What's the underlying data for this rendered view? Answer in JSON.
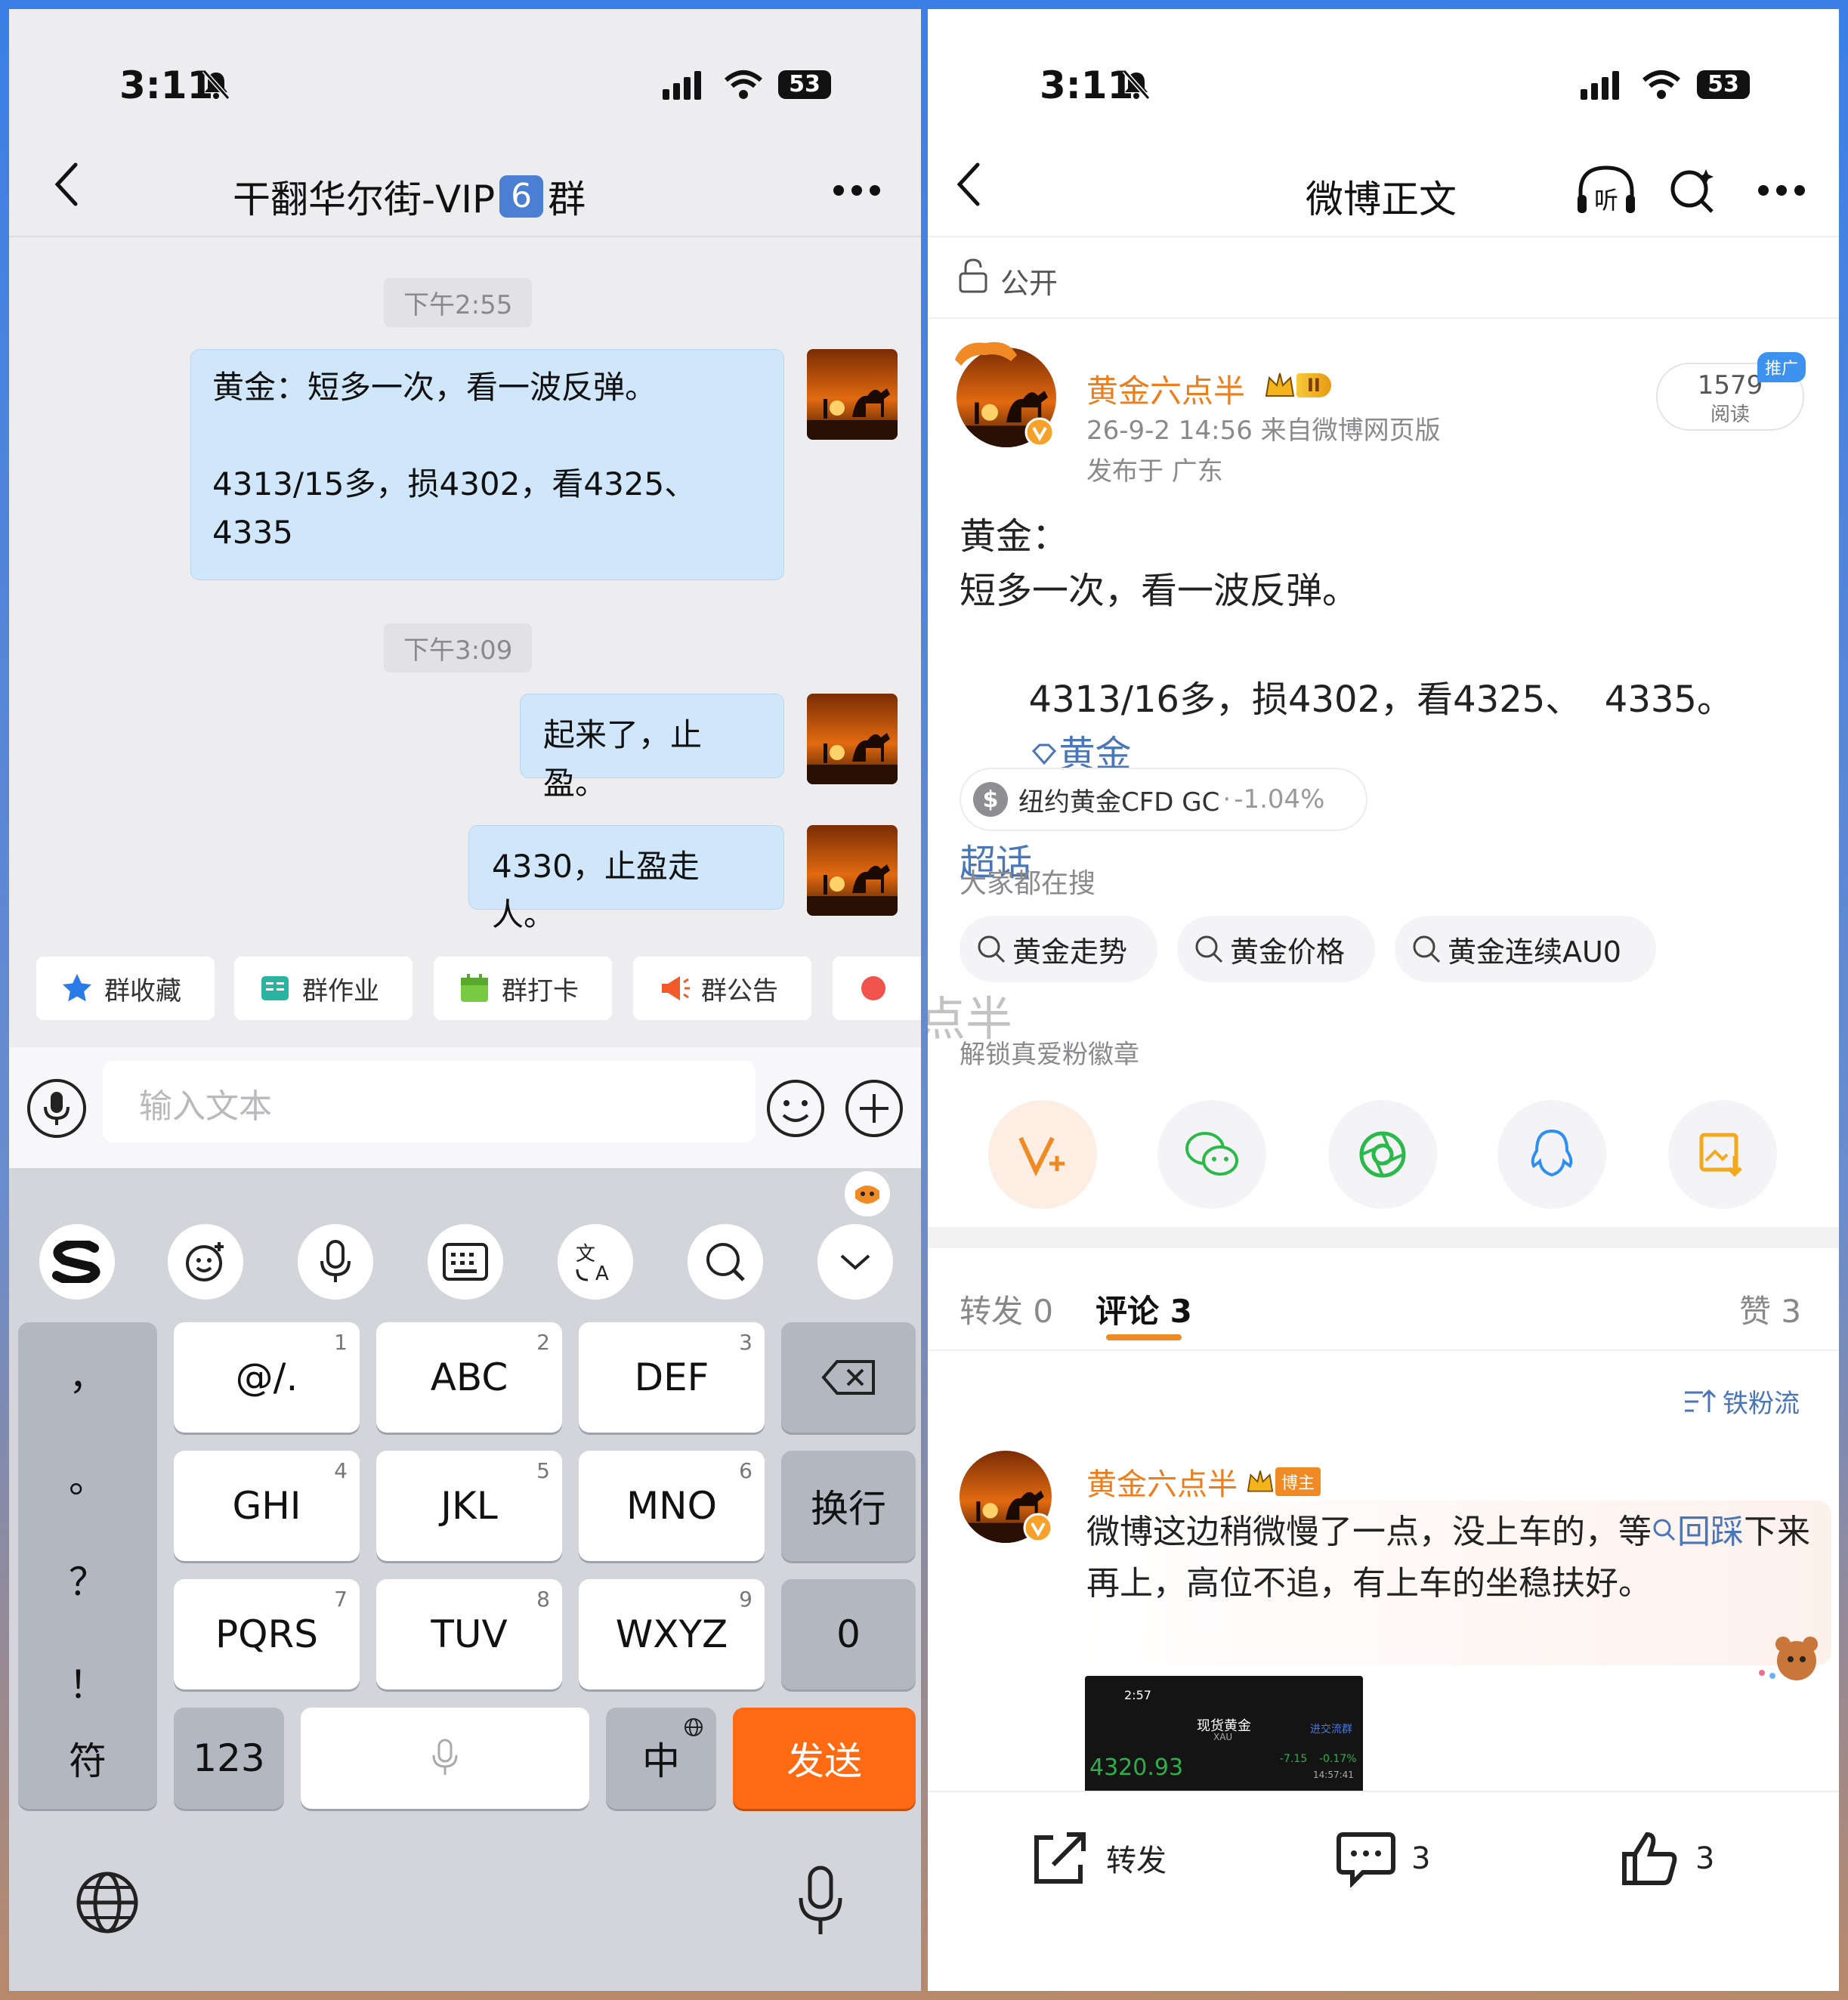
{
  "left": {
    "status": {
      "time": "3:11",
      "battery": "53"
    },
    "header": {
      "title_prefix": "干翻华尔街-VIP",
      "title_badge": "6",
      "title_suffix": "群"
    },
    "messages": [
      {
        "time": "下午2:55",
        "text": "黄金：短多一次，看一波反弹。\n\n4313/15多，损4302，看4325、 4335"
      },
      {
        "time": "下午3:09",
        "text": "起来了，止盈。"
      },
      {
        "text": "4330，止盈走人。"
      }
    ],
    "quick_actions": [
      "群收藏",
      "群作业",
      "群打卡",
      "群公告"
    ],
    "input": {
      "placeholder": "输入文本"
    },
    "keyboard": {
      "left_col": [
        "，",
        "。",
        "？",
        "！"
      ],
      "rows": [
        [
          {
            "label": "@/.",
            "num": "1"
          },
          {
            "label": "ABC",
            "num": "2"
          },
          {
            "label": "DEF",
            "num": "3"
          }
        ],
        [
          {
            "label": "GHI",
            "num": "4"
          },
          {
            "label": "JKL",
            "num": "5"
          },
          {
            "label": "MNO",
            "num": "6"
          }
        ],
        [
          {
            "label": "PQRS",
            "num": "7"
          },
          {
            "label": "TUV",
            "num": "8"
          },
          {
            "label": "WXYZ",
            "num": "9"
          }
        ]
      ],
      "newline": "换行",
      "zero": "0",
      "symbols": "符",
      "numbers": "123",
      "lang": "中",
      "send": "发送"
    }
  },
  "right": {
    "status": {
      "time": "3:11",
      "battery": "53"
    },
    "header": {
      "title": "微博正文",
      "listen_label": "听"
    },
    "visibility": "公开",
    "post": {
      "author": "黄金六点半",
      "level_badge": "II",
      "meta": "26-9-2 14:56  来自微博网页版",
      "location": "发布于 广东",
      "reads": "1579",
      "reads_label": "阅读",
      "promo_tag": "推广",
      "body_line1": "黄金：",
      "body_line2": "短多一次，看一波反弹。",
      "body_line3": "4313/16多，损4302，看4325、  4335。",
      "topic_link_a": "黄金",
      "topic_link_b": "超话",
      "quote_label": "纽约黄金CFD GC",
      "quote_change": "-1.04%"
    },
    "search": {
      "title": "大家都在搜",
      "chips": [
        "黄金走势",
        "黄金价格",
        "黄金连续AU0"
      ]
    },
    "watermark": "@黄金六点半",
    "fan_badge": "解锁真爱粉徽章",
    "tabs": {
      "repost": "转发",
      "repost_count": "0",
      "comments": "评论",
      "comments_count": "3",
      "likes": "赞",
      "likes_count": "3"
    },
    "sort_label": "铁粉流",
    "comment": {
      "author": "黄金六点半",
      "badge": "博主",
      "text_a": "微博这边稍微慢了一点，没上车的，等",
      "link": "回踩",
      "text_b": "下来再上，高位不追，有上车的坐稳扶好。"
    },
    "thumb": {
      "time": "2:57",
      "title": "现货黄金",
      "subtitle": "XAU",
      "price": "4320.93",
      "chg1": "-7.15",
      "chg2": "-0.17%",
      "clock": "14:57:41",
      "link": "进交流群"
    },
    "bottom": {
      "repost": "转发",
      "comments": "3",
      "likes": "3"
    },
    "colors": {
      "accent": "#ee7d1b",
      "link": "#4a76b8",
      "send": "#ff6a12"
    }
  }
}
